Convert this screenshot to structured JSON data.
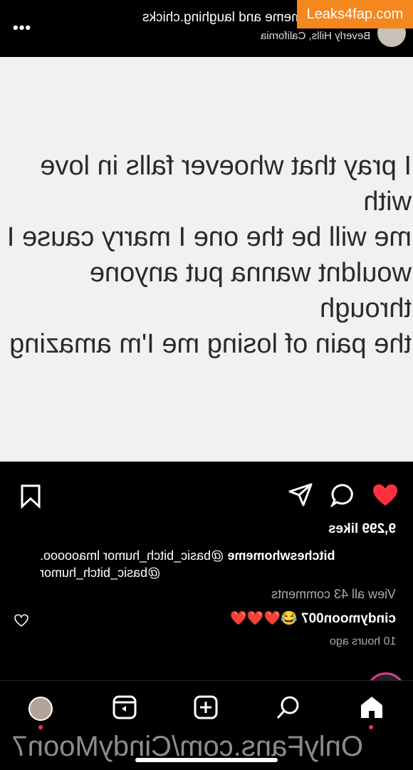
{
  "header": {
    "username": "bitcheswhomeme and laughing.chicks",
    "location": "Beverly Hills, California",
    "watermark": "Leaks4fap.com"
  },
  "post": {
    "text": "I pray that whoever falls in love with\nme will be the one I marry cause I\nwouldnt wanna put anyone through\nthe pain of losing me I'm amazing"
  },
  "engagement": {
    "likes": "9,299 likes",
    "caption_user": "bitcheswhomeme",
    "caption_text": " @basic_bitch_humor lmaooooo. @basic_bitch_humor",
    "view_comments": "View all 43 comments",
    "comment_user": "cindymoon007",
    "comment_text": " 😂❤️❤️❤️",
    "time_ago": "10 hours ago"
  },
  "watermark_bottom": "OnlyFans.com/CindyMoon7",
  "colors": {
    "heart": "#ff3040",
    "watermark": "#f5871f",
    "dot": "#ff2d55"
  },
  "icons": [
    "more-icon",
    "bookmark-icon",
    "share-icon",
    "comment-icon",
    "heart-icon",
    "reels-icon",
    "create-icon",
    "search-icon",
    "home-icon"
  ]
}
